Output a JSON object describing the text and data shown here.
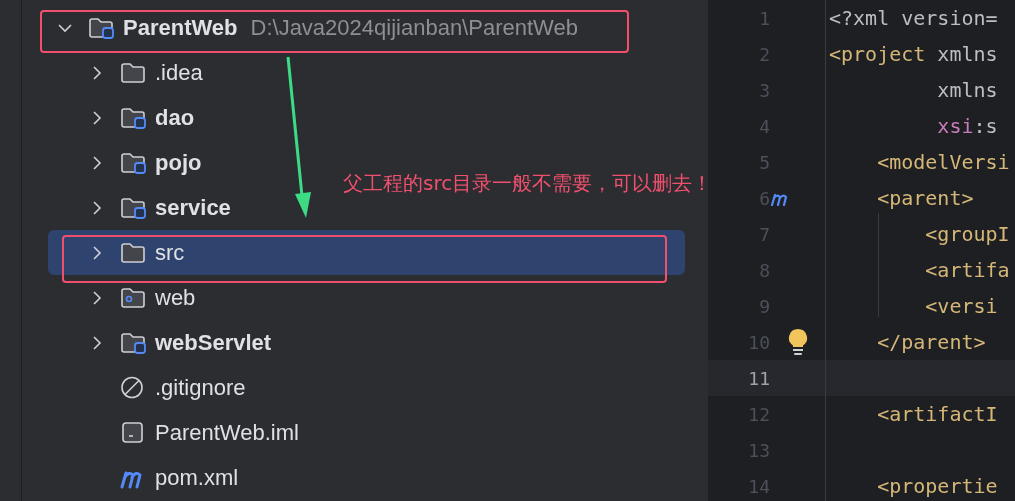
{
  "project_tree": {
    "root": {
      "name": "ParentWeb",
      "path": "D:\\Java2024qijianban\\ParentWeb",
      "kind": "module",
      "expanded": true,
      "selected": false,
      "children": [
        {
          "name": ".idea",
          "kind": "folder",
          "expanded": false,
          "selected": false
        },
        {
          "name": "dao",
          "kind": "module",
          "expanded": false,
          "selected": false
        },
        {
          "name": "pojo",
          "kind": "module",
          "expanded": false,
          "selected": false
        },
        {
          "name": "service",
          "kind": "module",
          "expanded": false,
          "selected": false
        },
        {
          "name": "src",
          "kind": "folder",
          "expanded": false,
          "selected": true
        },
        {
          "name": "web",
          "kind": "web",
          "expanded": false,
          "selected": false
        },
        {
          "name": "webServlet",
          "kind": "module",
          "expanded": false,
          "selected": false
        },
        {
          "name": ".gitignore",
          "kind": "ignore",
          "selected": false
        },
        {
          "name": "ParentWeb.iml",
          "kind": "iml",
          "selected": false
        },
        {
          "name": "pom.xml",
          "kind": "maven",
          "selected": false
        }
      ]
    }
  },
  "editor": {
    "lines": [
      {
        "number": "1",
        "current": false,
        "tokens": [
          {
            "text": "<?xml version=",
            "kind": "plain"
          }
        ]
      },
      {
        "number": "2",
        "current": false,
        "tokens": [
          {
            "text": "<project",
            "kind": "tag"
          },
          {
            "text": " xmlns",
            "kind": "plain"
          }
        ]
      },
      {
        "number": "3",
        "current": false,
        "tokens": [
          {
            "text": "         xmlns",
            "kind": "plain"
          }
        ]
      },
      {
        "number": "4",
        "current": false,
        "tokens": [
          {
            "text": "         xsi",
            "kind": "ns"
          },
          {
            "text": ":s",
            "kind": "plain"
          }
        ]
      },
      {
        "number": "5",
        "current": false,
        "tokens": [
          {
            "text": "    <modelVersi",
            "kind": "tag"
          }
        ]
      },
      {
        "number": "6",
        "current": false,
        "gutter": {
          "kind": "maven"
        },
        "tokens": [
          {
            "text": "    <parent>",
            "kind": "tag"
          }
        ]
      },
      {
        "number": "7",
        "current": false,
        "tokens": [
          {
            "text": "        <groupI",
            "kind": "tag"
          }
        ]
      },
      {
        "number": "8",
        "current": false,
        "tokens": [
          {
            "text": "        <artifa",
            "kind": "tag"
          }
        ]
      },
      {
        "number": "9",
        "current": false,
        "tokens": [
          {
            "text": "        <versi",
            "kind": "tag"
          }
        ]
      },
      {
        "number": "10",
        "current": false,
        "gutter": {
          "kind": "bulb"
        },
        "tokens": [
          {
            "text": "    </parent>",
            "kind": "tag"
          }
        ]
      },
      {
        "number": "11",
        "current": true
      },
      {
        "number": "12",
        "current": false,
        "tokens": [
          {
            "text": "    <artifactI",
            "kind": "tag"
          }
        ]
      },
      {
        "number": "13",
        "current": false
      },
      {
        "number": "14",
        "current": false,
        "tokens": [
          {
            "text": "    <propertie",
            "kind": "tag"
          }
        ]
      }
    ]
  },
  "annotation": {
    "text": "父工程的src目录一般不需要，可以删去！"
  }
}
